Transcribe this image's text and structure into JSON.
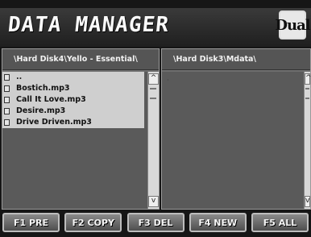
{
  "header": {
    "title": "DATA MANAGER",
    "logo": "Dual"
  },
  "left_panel": {
    "path": "\\Hard Disk4\\Yello - Essential\\",
    "up_item": "..",
    "files": [
      "Bostich.mp3",
      "Call It Love.mp3",
      "Desire.mp3",
      "Drive Driven.mp3"
    ]
  },
  "right_panel": {
    "path": "\\Hard Disk3\\Mdata\\"
  },
  "scroll": {
    "up": "^",
    "down": "v"
  },
  "fkeys": [
    "F1 PRE",
    "F2 COPY",
    "F3 DEL",
    "F4 NEW",
    "F5 ALL"
  ]
}
